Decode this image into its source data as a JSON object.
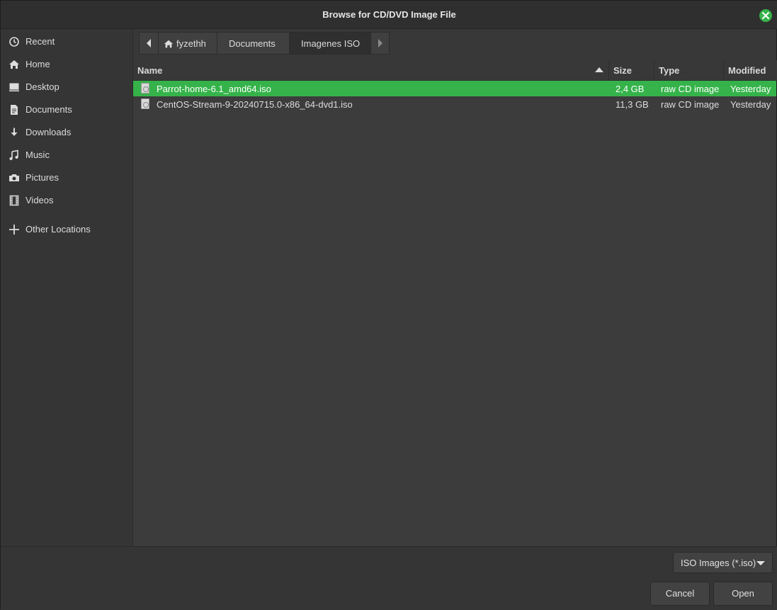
{
  "window": {
    "title": "Browse for CD/DVD Image File"
  },
  "sidebar": {
    "items": [
      {
        "label": "Recent",
        "icon": "clock-icon"
      },
      {
        "label": "Home",
        "icon": "home-icon"
      },
      {
        "label": "Desktop",
        "icon": "desktop-icon"
      },
      {
        "label": "Documents",
        "icon": "document-icon"
      },
      {
        "label": "Downloads",
        "icon": "download-icon"
      },
      {
        "label": "Music",
        "icon": "music-icon"
      },
      {
        "label": "Pictures",
        "icon": "camera-icon"
      },
      {
        "label": "Videos",
        "icon": "film-icon"
      },
      {
        "label": "Other Locations",
        "icon": "plus-icon"
      }
    ]
  },
  "pathbar": {
    "segments": [
      "fyzethh",
      "Documents",
      "Imagenes ISO"
    ],
    "active_segment": "Imagenes ISO"
  },
  "filelist": {
    "columns": [
      "Name",
      "Size",
      "Type",
      "Modified"
    ],
    "sort_column": "Name",
    "rows": [
      {
        "name": "Parrot-home-6.1_amd64.iso",
        "size": "2,4 GB",
        "type": "raw CD image",
        "modified": "Yesterday",
        "selected": true
      },
      {
        "name": "CentOS-Stream-9-20240715.0-x86_64-dvd1.iso",
        "size": "11,3 GB",
        "type": "raw CD image",
        "modified": "Yesterday",
        "selected": false
      }
    ]
  },
  "footer": {
    "filter_value": "ISO Images (*.iso)",
    "cancel_label": "Cancel",
    "open_label": "Open"
  },
  "colors": {
    "accent": "#35b34a",
    "background": "#383838",
    "sidebar": "#353535"
  }
}
